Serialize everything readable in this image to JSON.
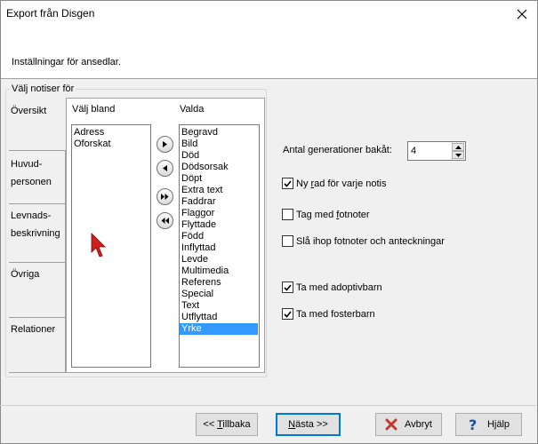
{
  "window": {
    "title": "Export från Disgen",
    "header": "Inställningar för ansedlar."
  },
  "group": {
    "label": "Välj notiser för"
  },
  "tabs": [
    {
      "line1": "Översikt",
      "line2": ""
    },
    {
      "line1": "Huvud-",
      "line2": "personen"
    },
    {
      "line1": "Levnads-",
      "line2": "beskrivning"
    },
    {
      "line1": "Övriga",
      "line2": ""
    },
    {
      "line1": "Relationer",
      "line2": ""
    }
  ],
  "panel": {
    "left_label": "Välj bland",
    "right_label": "Valda",
    "available": [
      "Adress",
      "Oforskat"
    ],
    "selected": [
      "Begravd",
      "Bild",
      "Död",
      "Dödsorsak",
      "Döpt",
      "Extra text",
      "Faddrar",
      "Flaggor",
      "Flyttade",
      "Född",
      "Inflyttad",
      "Levde",
      "Multimedia",
      "Referens",
      "Special",
      "Text",
      "Utflyttad",
      "Yrke"
    ],
    "highlighted": "Yrke"
  },
  "options": {
    "generations_label": "Antal generationer bakåt:",
    "generations_value": "4",
    "cb1_pre": "Ny ",
    "cb1_u": "r",
    "cb1_post": "ad för varje notis",
    "cb1_checked": true,
    "cb2_pre": "Tag med ",
    "cb2_u": "f",
    "cb2_post": "otnoter",
    "cb2_checked": false,
    "cb3_label": "Slå ihop fotnoter och anteckningar",
    "cb3_checked": false,
    "cb4_label": "Ta med adoptivbarn",
    "cb4_checked": true,
    "cb5_label": "Ta med fosterbarn",
    "cb5_checked": true
  },
  "buttons": {
    "back_pre": "<< ",
    "back_u": "T",
    "back_post": "illbaka",
    "next_u": "N",
    "next_post": "ästa >>",
    "cancel": "Avbryt",
    "help_pre": "H",
    "help_u": "j",
    "help_post": "älp"
  },
  "colors": {
    "selection": "#3399ff",
    "default_button_border": "#0078d7",
    "cancel_icon": "#c0392b",
    "help_icon": "#1f4fa0",
    "cursor": "#cc1f1f"
  }
}
